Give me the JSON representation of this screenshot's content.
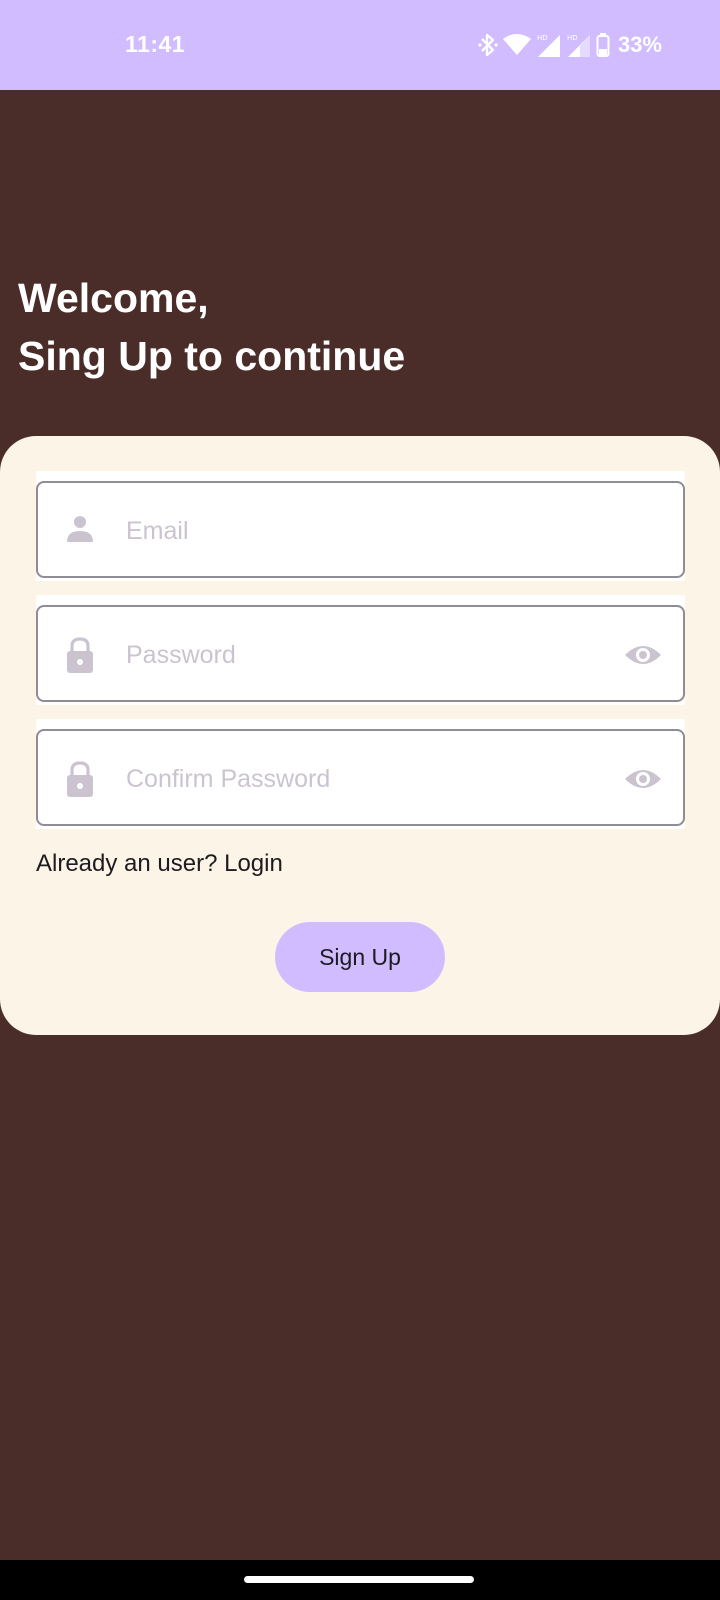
{
  "status_bar": {
    "time": "11:41",
    "battery_percent": "33%",
    "icons": [
      "bluetooth-icon",
      "wifi-icon",
      "signal-hd-icon",
      "signal-hd-icon",
      "battery-icon"
    ]
  },
  "header": {
    "line1": "Welcome,",
    "line2": "Sing Up to continue"
  },
  "form": {
    "email": {
      "placeholder": "Email",
      "value": "",
      "icon": "person-icon"
    },
    "password": {
      "placeholder": "Password",
      "value": "",
      "icon": "lock-icon",
      "toggle_icon": "eye-icon"
    },
    "confirm_password": {
      "placeholder": "Confirm Password",
      "value": "",
      "icon": "lock-icon",
      "toggle_icon": "eye-icon"
    },
    "login_link": "Already an user? Login",
    "submit_label": "Sign Up"
  },
  "colors": {
    "background": "#4a2d29",
    "accent": "#d0bcff",
    "card": "#fcf4e6",
    "placeholder": "#cbc4d0"
  }
}
